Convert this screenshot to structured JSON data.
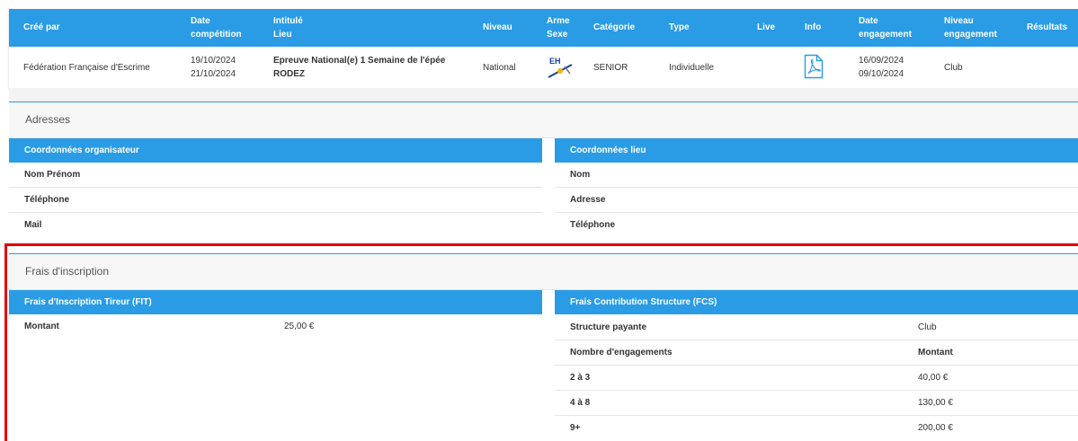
{
  "competition_table": {
    "headers": {
      "cree_par": "Créé par",
      "date_line1": "Date",
      "date_line2": "compétition",
      "intitule_line1": "Intitulé",
      "intitule_line2": "Lieu",
      "niveau": "Niveau",
      "arme_line1": "Arme",
      "arme_line2": "Sexe",
      "categorie": "Catégorie",
      "type": "Type",
      "live": "Live",
      "info": "Info",
      "date_eng_line1": "Date",
      "date_eng_line2": "engagement",
      "niveau_eng_line1": "Niveau",
      "niveau_eng_line2": "engagement",
      "resultats": "Résultats"
    },
    "row": {
      "cree_par": "Fédération Française d'Escrime",
      "date_start": "19/10/2024",
      "date_end": "21/10/2024",
      "intitule": "Epreuve National(e) 1 Semaine de l'épée",
      "lieu": "RODEZ",
      "niveau": "National",
      "arme_icon": "epee-homme-icon",
      "arme_icon_text": "EH",
      "categorie": "SENIOR",
      "type": "Individuelle",
      "info_icon": "pdf-icon",
      "date_eng_start": "16/09/2024",
      "date_eng_end": "09/10/2024",
      "niveau_eng": "Club"
    }
  },
  "adresses": {
    "title": "Adresses",
    "organisateur": {
      "heading": "Coordonnées organisateur",
      "fields": [
        "Nom Prénom",
        "Téléphone",
        "Mail"
      ]
    },
    "lieu": {
      "heading": "Coordonnées lieu",
      "fields": [
        "Nom",
        "Adresse",
        "Téléphone"
      ]
    }
  },
  "frais": {
    "title": "Frais d'inscription",
    "fit": {
      "heading": "Frais d'Inscription Tireur (FIT)",
      "label": "Montant",
      "value": "25,00 €"
    },
    "fcs": {
      "heading": "Frais Contribution Structure (FCS)",
      "structure_label": "Structure payante",
      "structure_value": "Club",
      "col_left": "Nombre d'engagements",
      "col_right": "Montant",
      "rows": [
        {
          "range": "2 à 3",
          "amount": "40,00 €"
        },
        {
          "range": "4 à 8",
          "amount": "130,00 €"
        },
        {
          "range": "9+",
          "amount": "200,00 €"
        }
      ]
    }
  },
  "colors": {
    "header_blue": "#2a9ce6",
    "highlight_red": "#e50000"
  }
}
